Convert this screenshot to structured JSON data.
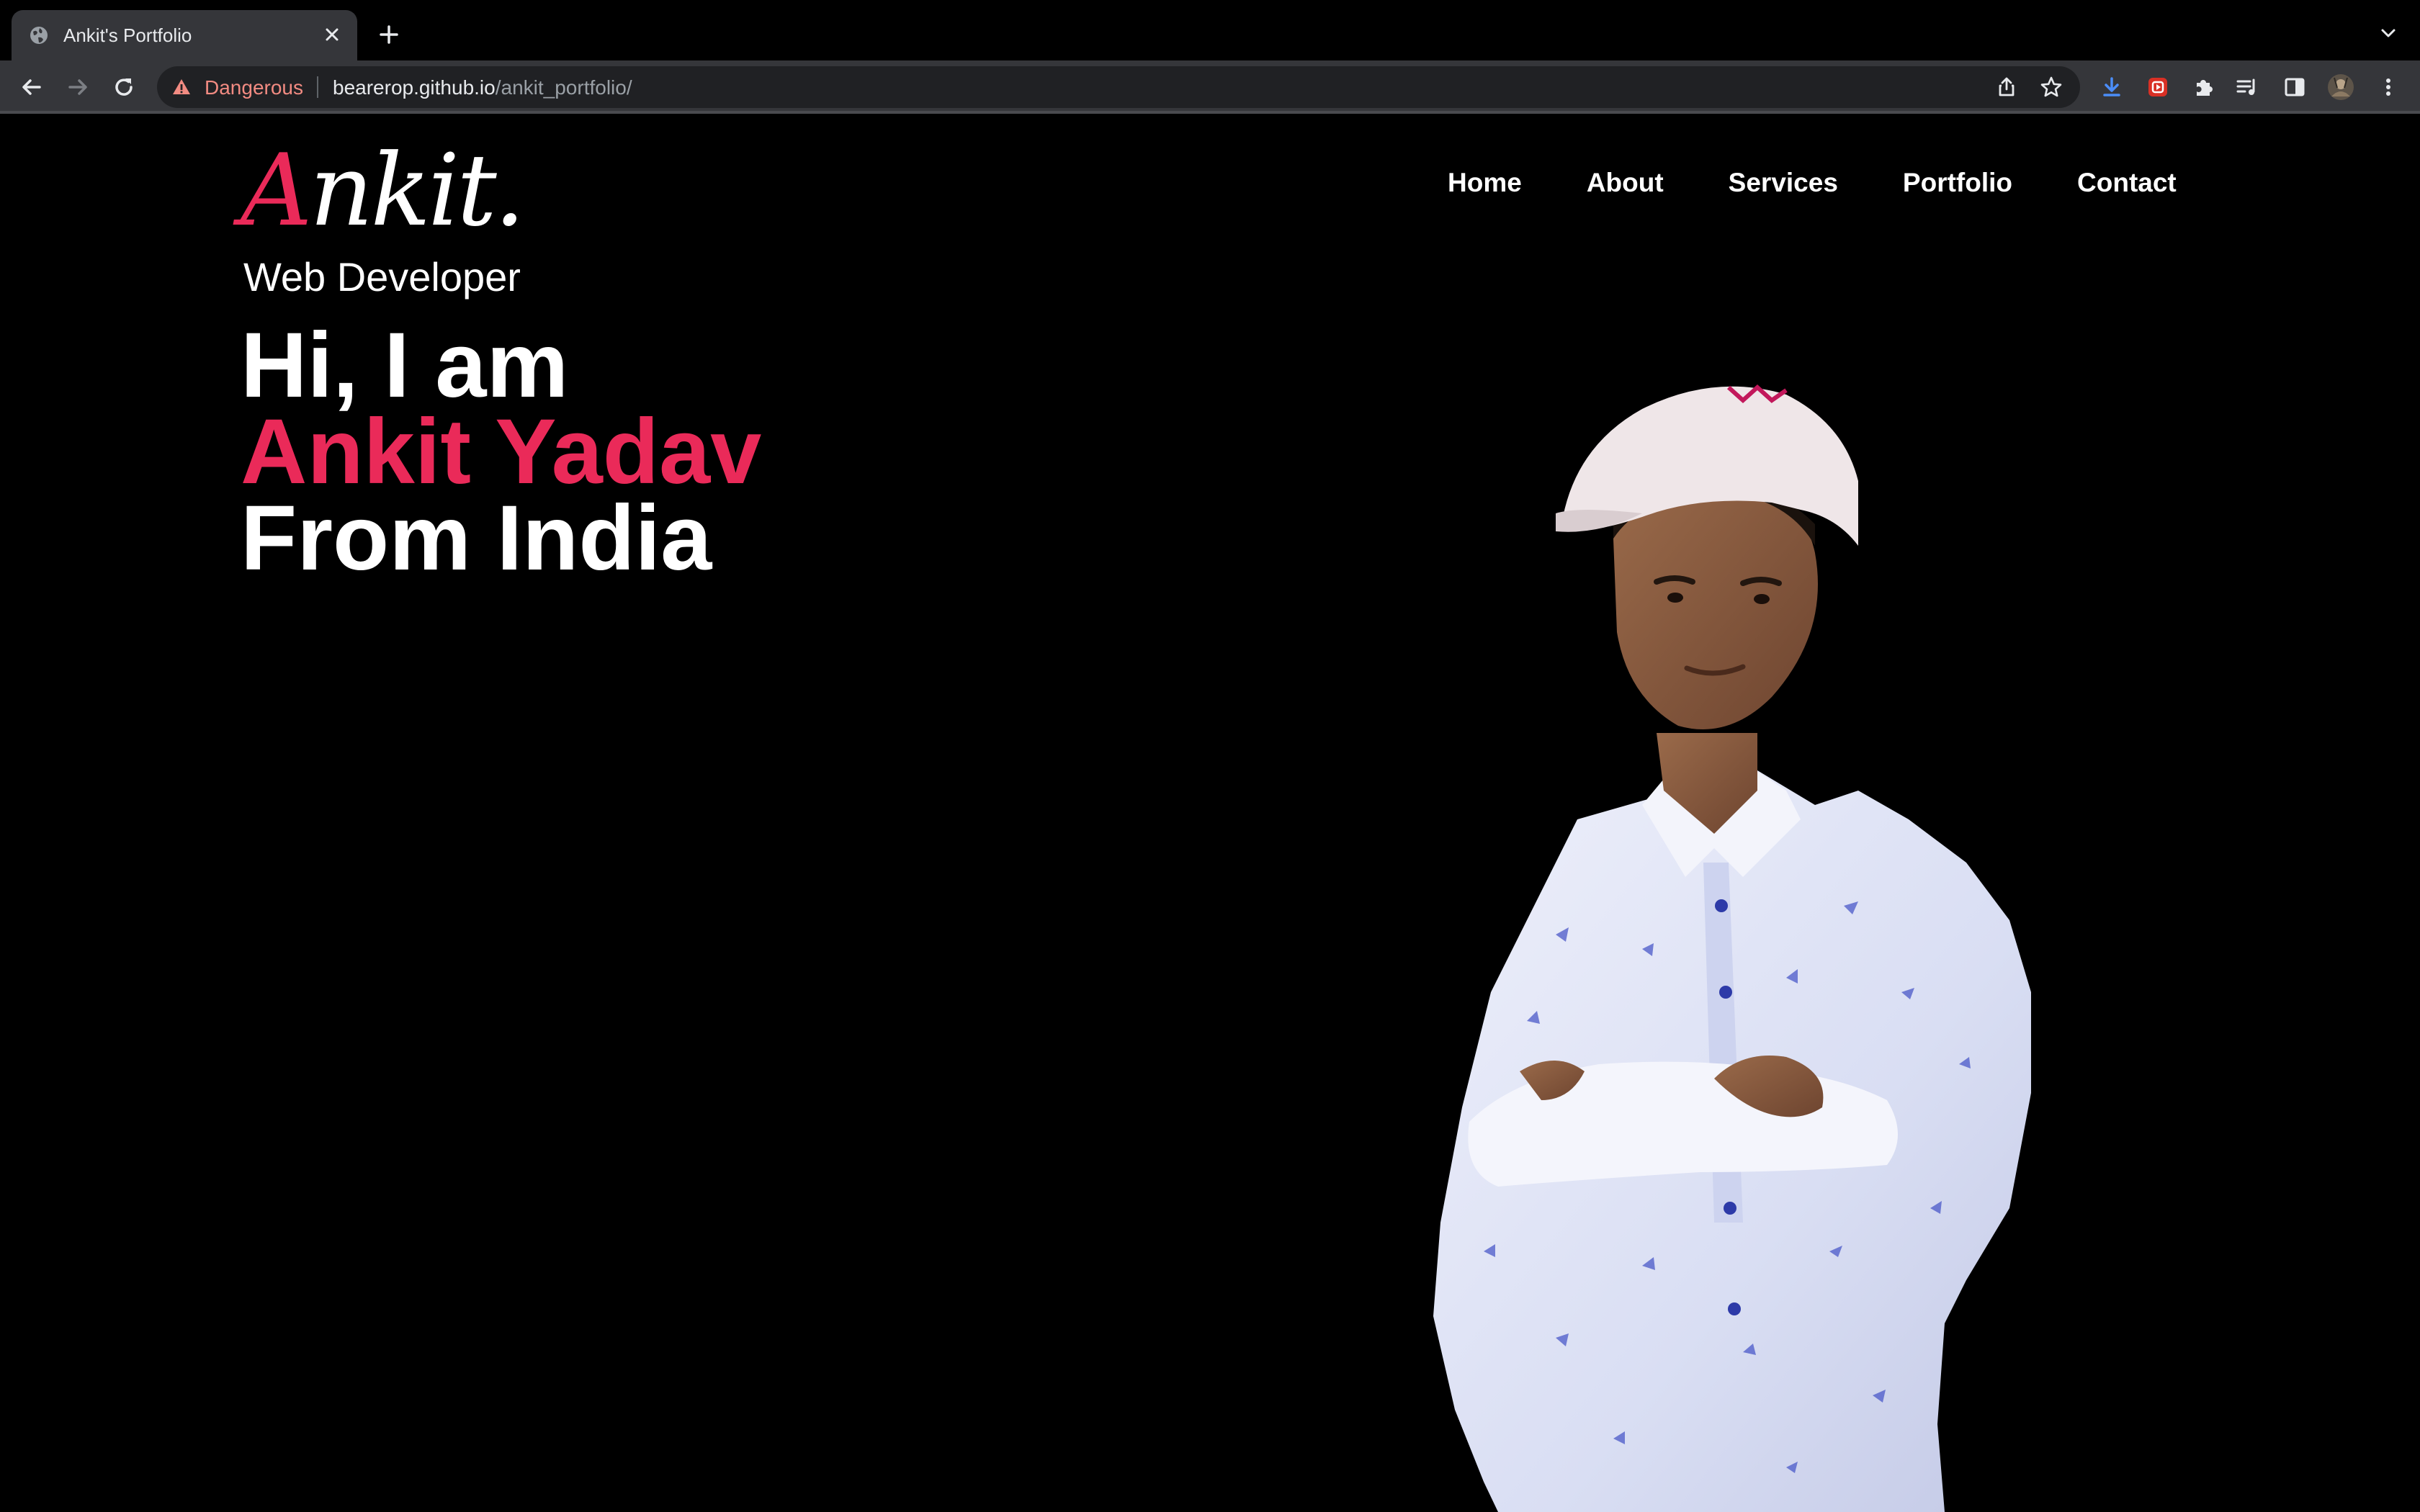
{
  "browser": {
    "tab_title": "Ankit's Portfolio",
    "security_label": "Dangerous",
    "url_host": "bearerop.github.io",
    "url_path": "/ankit_portfolio/"
  },
  "site": {
    "logo_first": "A",
    "logo_rest": "nkit.",
    "nav": [
      "Home",
      "About",
      "Services",
      "Portfolio",
      "Contact"
    ],
    "role": "Web Developer",
    "hero_line1": "Hi, I am",
    "hero_name": "Ankit Yadav",
    "hero_line3": "From India",
    "accent_color": "#ea2a59"
  },
  "icons": {
    "tab": [
      "globe-icon",
      "close-icon"
    ],
    "tabstrip": [
      "plus-icon",
      "chevron-down-icon"
    ],
    "toolbar": [
      "back-arrow-icon",
      "forward-arrow-icon",
      "reload-icon",
      "warning-triangle-icon",
      "share-icon",
      "star-icon",
      "download-icon",
      "extension-red-icon",
      "puzzle-icon",
      "reading-list-icon",
      "side-panel-icon",
      "profile-avatar",
      "kebab-menu-icon"
    ]
  }
}
